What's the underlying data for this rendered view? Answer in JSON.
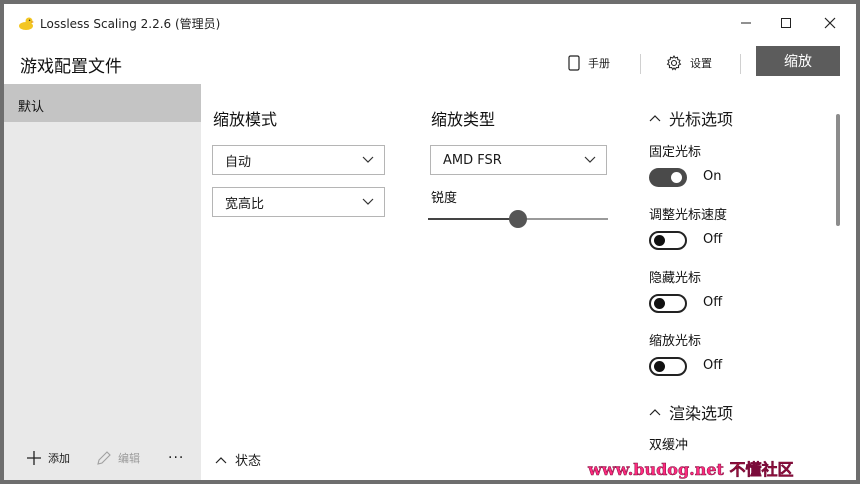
{
  "window": {
    "title": "Lossless Scaling 2.2.6 (管理员)",
    "controls": {
      "minimize": "—",
      "maximize": "☐",
      "close": "✕"
    }
  },
  "header": {
    "title": "游戏配置文件",
    "manual_label": "手册",
    "settings_label": "设置",
    "scale_label": "缩放"
  },
  "sidebar": {
    "profiles": [
      {
        "label": "默认",
        "selected": true
      }
    ],
    "add_label": "添加",
    "edit_label": "编辑",
    "more_label": "···"
  },
  "scaling_mode": {
    "title": "缩放模式",
    "mode_value": "自动",
    "aspect_value": "宽高比"
  },
  "scaling_type": {
    "title": "缩放类型",
    "type_value": "AMD FSR",
    "sharpness_label": "锐度",
    "sharpness_level": 0.5
  },
  "status_label": "状态",
  "cursor_options": {
    "title": "光标选项",
    "items": [
      {
        "label": "固定光标",
        "state": "On"
      },
      {
        "label": "调整光标速度",
        "state": "Off"
      },
      {
        "label": "隐藏光标",
        "state": "Off"
      },
      {
        "label": "缩放光标",
        "state": "Off"
      }
    ]
  },
  "render_options": {
    "title": "渲染选项",
    "first_item": "双缓冲"
  },
  "watermark": {
    "text": "www.budog.net",
    "cn": "不懂社区"
  },
  "colors": {
    "accent": "#5c5c5c",
    "sidebar": "#e9e9e9",
    "selected": "#c4c4c4"
  }
}
